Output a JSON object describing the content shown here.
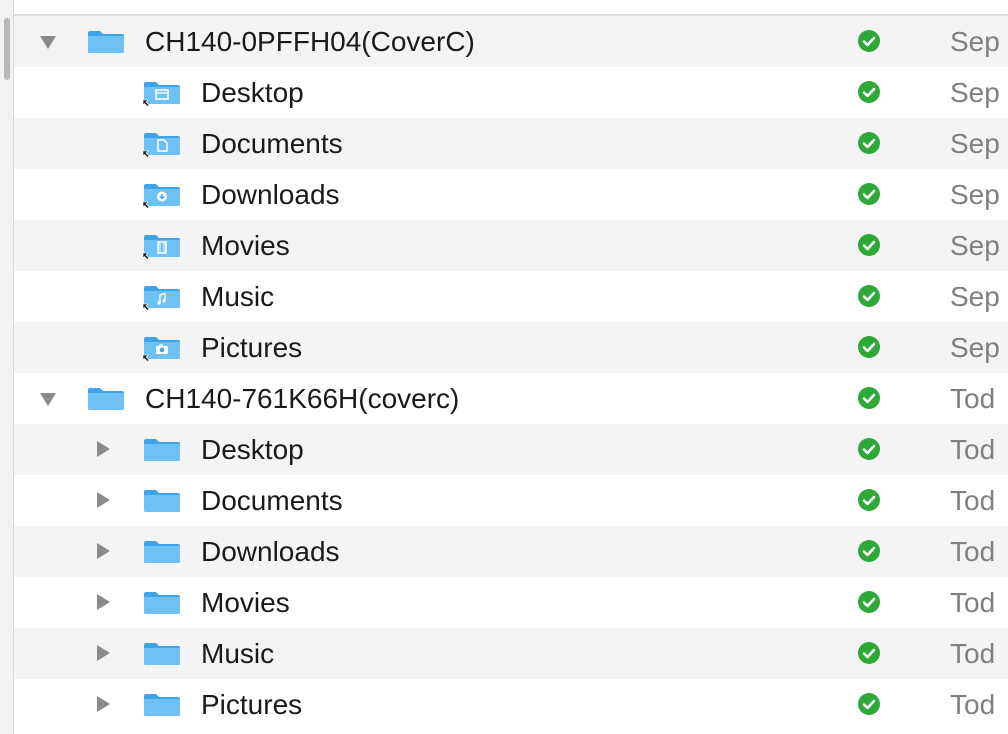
{
  "colors": {
    "folder": "#6ec1f4",
    "folder_dark": "#3ea4ea",
    "status_ok": "#2ea836",
    "row_alt": "#f4f4f4",
    "date_text": "#808080"
  },
  "rows": [
    {
      "name": "CH140-0PFFH04(CoverC)",
      "date": "Sep",
      "level": 0,
      "disclosure": "expanded",
      "icon": "folder-icon",
      "status": "synced-check-icon"
    },
    {
      "name": "Desktop",
      "date": "Sep",
      "level": 1,
      "disclosure": "none",
      "icon": "desktop-folder-alias-icon",
      "status": "synced-check-icon"
    },
    {
      "name": "Documents",
      "date": "Sep",
      "level": 1,
      "disclosure": "none",
      "icon": "documents-folder-alias-icon",
      "status": "synced-check-icon"
    },
    {
      "name": "Downloads",
      "date": "Sep",
      "level": 1,
      "disclosure": "none",
      "icon": "downloads-folder-alias-icon",
      "status": "synced-check-icon"
    },
    {
      "name": "Movies",
      "date": "Sep",
      "level": 1,
      "disclosure": "none",
      "icon": "movies-folder-alias-icon",
      "status": "synced-check-icon"
    },
    {
      "name": "Music",
      "date": "Sep",
      "level": 1,
      "disclosure": "none",
      "icon": "music-folder-alias-icon",
      "status": "synced-check-icon"
    },
    {
      "name": "Pictures",
      "date": "Sep",
      "level": 1,
      "disclosure": "none",
      "icon": "pictures-folder-alias-icon",
      "status": "synced-check-icon"
    },
    {
      "name": "CH140-761K66H(coverc)",
      "date": "Tod",
      "level": 0,
      "disclosure": "expanded",
      "icon": "folder-icon",
      "status": "synced-check-icon"
    },
    {
      "name": "Desktop",
      "date": "Tod",
      "level": 1,
      "disclosure": "collapsed",
      "icon": "folder-icon",
      "status": "synced-check-icon"
    },
    {
      "name": "Documents",
      "date": "Tod",
      "level": 1,
      "disclosure": "collapsed",
      "icon": "folder-icon",
      "status": "synced-check-icon"
    },
    {
      "name": "Downloads",
      "date": "Tod",
      "level": 1,
      "disclosure": "collapsed",
      "icon": "folder-icon",
      "status": "synced-check-icon"
    },
    {
      "name": "Movies",
      "date": "Tod",
      "level": 1,
      "disclosure": "collapsed",
      "icon": "folder-icon",
      "status": "synced-check-icon"
    },
    {
      "name": "Music",
      "date": "Tod",
      "level": 1,
      "disclosure": "collapsed",
      "icon": "folder-icon",
      "status": "synced-check-icon"
    },
    {
      "name": "Pictures",
      "date": "Tod",
      "level": 1,
      "disclosure": "collapsed",
      "icon": "folder-icon",
      "status": "synced-check-icon"
    }
  ]
}
